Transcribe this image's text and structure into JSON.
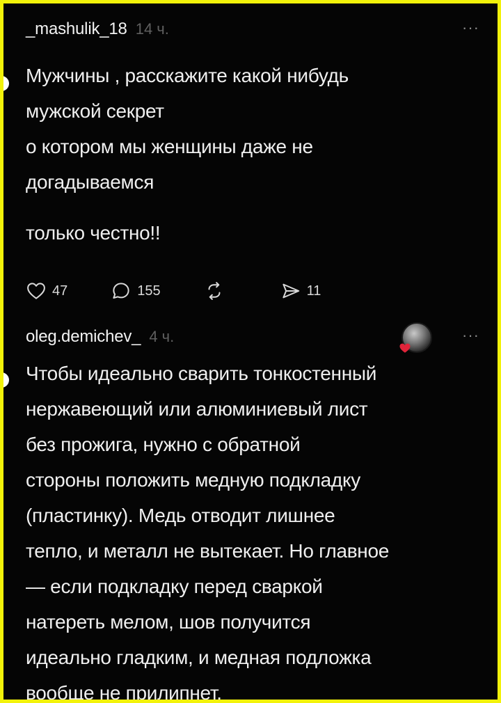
{
  "posts": [
    {
      "username": "_mashulik_18",
      "time": "14 ч.",
      "more": "···",
      "lines": [
        "Мужчины , расскажите какой нибудь",
        "мужской секрет",
        "о котором мы женщины  даже не",
        "догадываемся"
      ],
      "extra": "только честно!!",
      "likes": "47",
      "comments": "155",
      "shares": "11"
    },
    {
      "username": "oleg.demichev_",
      "time": "4 ч.",
      "more": "···",
      "lines": [
        "Чтобы идеально сварить тонкостенный",
        "нержавеющий или алюминиевый лист",
        "без прожига, нужно с обратной",
        "стороны положить медную подкладку",
        "(пластинку). Медь отводит лишнее",
        "тепло, и металл не вытекает. Но главное",
        "— если подкладку перед сваркой",
        "натереть мелом, шов получится",
        "идеально гладким, и медная подложка",
        "вообще не прилипнет."
      ]
    }
  ],
  "icons": {
    "like": "heart-icon",
    "comment": "comment-icon",
    "repost": "repost-icon",
    "share": "send-icon",
    "avatar_badge": "heart-icon"
  },
  "colors": {
    "background": "#050505",
    "border": "#f2f20a",
    "text": "#efefef",
    "muted": "#5f5f5f",
    "badge": "#e0243a"
  }
}
